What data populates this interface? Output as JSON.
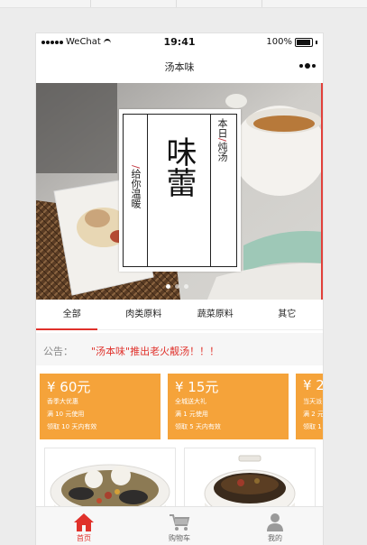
{
  "status_bar": {
    "carrier": "WeChat",
    "time": "19:41",
    "battery": "100%"
  },
  "navbar": {
    "title": "汤本味",
    "more_icon": "more-dots-icon"
  },
  "banner": {
    "poster_big": "味蕾",
    "poster_right": "本日/炖汤",
    "poster_right_a": "本日",
    "poster_right_slash": "/",
    "poster_right_b": "炖汤",
    "poster_left_slash": "/",
    "poster_left": "给你温暖",
    "slides": 3,
    "active_slide": 1
  },
  "tabs": [
    {
      "label": "全部",
      "active": true
    },
    {
      "label": "肉类原料",
      "active": false
    },
    {
      "label": "蔬菜原料",
      "active": false
    },
    {
      "label": "其它",
      "active": false
    }
  ],
  "notice": {
    "label": "公告：",
    "message": "\"汤本味\"推出老火靓汤！！！"
  },
  "coupons": [
    {
      "price": "¥ 60元",
      "name": "香季大优惠",
      "condition": "满 10 元使用",
      "validity": "领取 10 天内有效"
    },
    {
      "price": "¥ 15元",
      "name": "全城送大礼",
      "condition": "满 1 元使用",
      "validity": "领取 5 天内有效"
    },
    {
      "price": "¥ 2",
      "name": "当天派",
      "condition": "满 2 元",
      "validity": "领取 1"
    }
  ],
  "tabbar": [
    {
      "label": "首页",
      "icon": "home-icon",
      "active": true
    },
    {
      "label": "购物车",
      "icon": "cart-icon",
      "active": false
    },
    {
      "label": "我的",
      "icon": "user-icon",
      "active": false
    }
  ],
  "colors": {
    "accent_red": "#e0312b",
    "coupon_orange": "#f5a33a"
  }
}
